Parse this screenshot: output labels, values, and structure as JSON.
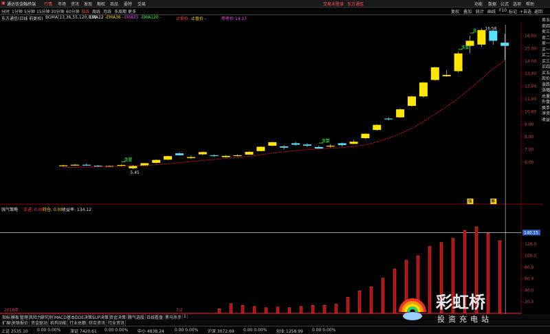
{
  "menubar": {
    "app_title": "通达信金融终端",
    "menu": [
      "行情",
      "市场",
      "资讯",
      "发现",
      "期权",
      "商品",
      "委特",
      "交易"
    ],
    "broker_promo": "交易未登录",
    "broker_name": "东方通信",
    "right_menu": [
      "功能",
      "数据",
      "公式",
      "选项",
      "帮助"
    ]
  },
  "toolbar": {
    "periods": [
      "分时",
      "1分钟",
      "5分钟",
      "15分钟",
      "30分钟",
      "60分钟",
      "日线",
      "周线",
      "月线",
      "多周期",
      "更多"
    ],
    "right_tools": [
      "复权",
      "叠加",
      "统计",
      "画线",
      "F10",
      "标记",
      "+自选",
      "返回"
    ]
  },
  "main_info": {
    "security": "东方通信(日线 前复权)",
    "indicator": "BGMA(13,36,55,120,0,0)",
    "ma_labels": [
      {
        "text": "EMA12 -",
        "color": "#ffffff"
      },
      {
        "text": "EMA36 -",
        "color": "#ffd800"
      },
      {
        "text": "EMA55 -",
        "color": "#ff40ff"
      },
      {
        "text": "EMA120 -",
        "color": "#3cff3c"
      }
    ],
    "stop_loss": "止损价 -",
    "stop_profit": "止盈价 -",
    "ref_price": "参考价 14.17"
  },
  "chart_data": {
    "type": "candlestick",
    "y_ticks": [
      "16.00",
      "15.00",
      "14.00",
      "13.00",
      "12.00",
      "11.00",
      "10.00",
      "9.00",
      "8.00",
      "7.00",
      "6.00"
    ],
    "candles": [
      {
        "o": 5.72,
        "h": 5.8,
        "l": 5.65,
        "c": 5.75
      },
      {
        "o": 5.75,
        "h": 5.85,
        "l": 5.7,
        "c": 5.8
      },
      {
        "o": 5.8,
        "h": 5.9,
        "l": 5.7,
        "c": 5.75
      },
      {
        "o": 5.72,
        "h": 5.78,
        "l": 5.62,
        "c": 5.68
      },
      {
        "o": 5.68,
        "h": 5.75,
        "l": 5.62,
        "c": 5.7
      },
      {
        "o": 5.72,
        "h": 5.82,
        "l": 5.66,
        "c": 5.78
      },
      {
        "o": 5.52,
        "h": 5.78,
        "l": 5.45,
        "c": 5.72
      },
      {
        "o": 5.72,
        "h": 5.95,
        "l": 5.7,
        "c": 5.92
      },
      {
        "o": 5.95,
        "h": 6.22,
        "l": 5.9,
        "c": 6.18
      },
      {
        "o": 6.2,
        "h": 6.52,
        "l": 6.15,
        "c": 6.48
      },
      {
        "o": 6.7,
        "h": 6.8,
        "l": 6.5,
        "c": 6.55
      },
      {
        "o": 6.32,
        "h": 6.55,
        "l": 6.25,
        "c": 6.4
      },
      {
        "o": 6.62,
        "h": 6.85,
        "l": 6.55,
        "c": 6.8
      },
      {
        "o": 6.55,
        "h": 6.62,
        "l": 6.42,
        "c": 6.5
      },
      {
        "o": 6.4,
        "h": 6.55,
        "l": 6.35,
        "c": 6.5
      },
      {
        "o": 6.52,
        "h": 6.62,
        "l": 6.45,
        "c": 6.55
      },
      {
        "o": 6.6,
        "h": 6.85,
        "l": 6.58,
        "c": 6.82
      },
      {
        "o": 6.88,
        "h": 7.25,
        "l": 6.85,
        "c": 7.22
      },
      {
        "o": 7.3,
        "h": 7.62,
        "l": 7.25,
        "c": 7.58
      },
      {
        "o": 7.25,
        "h": 7.35,
        "l": 7.0,
        "c": 7.15
      },
      {
        "o": 7.5,
        "h": 7.62,
        "l": 7.3,
        "c": 7.38
      },
      {
        "o": 7.4,
        "h": 7.5,
        "l": 7.2,
        "c": 7.3
      },
      {
        "o": 7.2,
        "h": 7.3,
        "l": 7.0,
        "c": 7.08
      },
      {
        "o": 7.3,
        "h": 7.42,
        "l": 7.15,
        "c": 7.3
      },
      {
        "o": 7.5,
        "h": 7.55,
        "l": 7.25,
        "c": 7.35
      },
      {
        "o": 7.45,
        "h": 7.75,
        "l": 7.42,
        "c": 7.62
      },
      {
        "o": 7.9,
        "h": 8.28,
        "l": 7.85,
        "c": 8.25
      },
      {
        "o": 8.55,
        "h": 9.0,
        "l": 8.5,
        "c": 8.95
      },
      {
        "o": 9.45,
        "h": 9.55,
        "l": 9.3,
        "c": 9.4
      },
      {
        "o": 9.55,
        "h": 10.25,
        "l": 9.5,
        "c": 10.18
      },
      {
        "o": 10.45,
        "h": 11.25,
        "l": 10.4,
        "c": 11.2
      },
      {
        "o": 11.2,
        "h": 12.35,
        "l": 11.1,
        "c": 12.3
      },
      {
        "o": 12.5,
        "h": 13.55,
        "l": 12.45,
        "c": 13.5
      },
      {
        "o": 12.8,
        "h": 13.3,
        "l": 12.75,
        "c": 12.9
      },
      {
        "o": 13.2,
        "h": 14.7,
        "l": 13.1,
        "c": 14.6
      },
      {
        "o": 15.2,
        "h": 16.0,
        "l": 14.6,
        "c": 15.6
      },
      {
        "o": 15.3,
        "h": 16.58,
        "l": 15.1,
        "c": 16.45
      },
      {
        "o": 16.4,
        "h": 16.45,
        "l": 15.3,
        "c": 15.6
      },
      {
        "o": 15.45,
        "h": 16.15,
        "l": 14.1,
        "c": 15.2
      }
    ],
    "ema_line": [
      5.58,
      5.6,
      5.62,
      5.64,
      5.66,
      5.68,
      5.7,
      5.74,
      5.8,
      5.88,
      5.97,
      6.05,
      6.14,
      6.22,
      6.3,
      6.38,
      6.47,
      6.58,
      6.72,
      6.82,
      6.92,
      7.0,
      7.05,
      7.1,
      7.16,
      7.24,
      7.38,
      7.6,
      7.9,
      8.25,
      8.68,
      9.2,
      9.8,
      10.4,
      11.05,
      11.8,
      12.6,
      13.4,
      14.05
    ],
    "high_label": "16.58",
    "low_label": "5.45",
    "buy_signals": [
      {
        "index": 5,
        "text": "贪婪"
      },
      {
        "index": 22,
        "text": "贪婪"
      },
      {
        "index": 34,
        "text": "贪婪"
      },
      {
        "index": 35,
        "text": "贪"
      }
    ],
    "bottom_markers": [
      {
        "index": 35,
        "text": "强"
      },
      {
        "index": 37,
        "text": "筹"
      }
    ],
    "sub_indicator": {
      "name": "强气策略",
      "buy_label": "买进: 0.00",
      "hold_label": "持仓: 0.00",
      "income_label": "收益率: 134.12",
      "current_value": "140.15",
      "y_ticks": [
        "120.0",
        "100.0",
        "80.0",
        "60.0",
        "40.0",
        "20.0"
      ],
      "values": [
        0,
        0,
        0,
        0,
        0,
        0,
        0,
        0,
        0,
        0,
        0,
        0,
        0,
        0,
        0,
        0,
        0,
        0,
        0,
        8,
        17,
        14,
        12,
        10,
        11,
        10,
        12,
        14,
        14,
        16,
        28,
        39,
        46,
        61,
        77,
        92,
        100,
        116,
        123,
        130,
        144,
        150,
        139,
        126
      ]
    },
    "date_labels": [
      "2018年",
      "7/2"
    ]
  },
  "tabs1": [
    "指标",
    "模板",
    "管理",
    "风险力",
    "研究例",
    "MACD基本",
    "DDE决策",
    "SUP决策",
    "资金决策",
    "腾气选股",
    "日线看盘",
    "黑马杀手",
    "1"
  ],
  "tabs2": [
    "扩展\\",
    "关联报价",
    "资金驱动",
    "机构动能",
    "行业总额",
    "综合资讯",
    "行业资讯"
  ],
  "status": [
    {
      "text": "上证 2535.10",
      "color": "#dddddd"
    },
    {
      "text": "0.00 0.00%",
      "color": "#dddddd"
    },
    {
      "text": "深证 7420.61",
      "color": "#dddddd"
    },
    {
      "text": "0.00 0.00%",
      "color": "#dddddd"
    },
    {
      "text": "中小 4838.24",
      "color": "#dddddd"
    },
    {
      "text": "0.00 0.00%",
      "color": "#dddddd"
    },
    {
      "text": "沪深 3072.69",
      "color": "#dddddd"
    },
    {
      "text": "0.00 0.00%",
      "color": "#dddddd"
    },
    {
      "text": "创业 1258.99",
      "color": "#dddddd"
    },
    {
      "text": "0.00 0.00%",
      "color": "#dddddd"
    }
  ],
  "right_panel": [
    "卖五",
    "卖四",
    "卖三",
    "卖二",
    "卖一",
    "买一",
    "买二",
    "买三",
    "买四",
    "买五",
    "现价",
    "涨跌",
    "涨幅",
    "总量",
    "外盘",
    "换手",
    "净资",
    "收益"
  ],
  "watermark": {
    "line1": "彩虹桥",
    "line2": "投资充电站"
  },
  "colors": {
    "up": "#ffe600",
    "down": "#55e0ff",
    "ema": "#c01515",
    "grid": "#700000"
  }
}
